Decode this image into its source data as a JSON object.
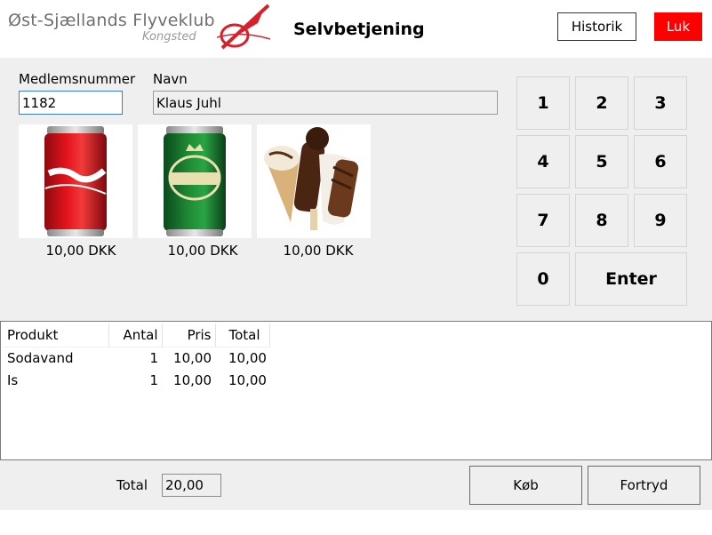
{
  "header": {
    "club_name": "Øst-Sjællands Flyveklub",
    "club_location": "Kongsted",
    "app_title": "Selvbetjening",
    "history_label": "Historik",
    "close_label": "Luk"
  },
  "member": {
    "number_label": "Medlemsnummer",
    "number_value": "1182",
    "name_label": "Navn",
    "name_value": "Klaus Juhl"
  },
  "products": [
    {
      "name": "coca-cola",
      "price": "10,00 DKK"
    },
    {
      "name": "tuborg",
      "price": "10,00 DKK"
    },
    {
      "name": "ice-cream",
      "price": "10,00 DKK"
    }
  ],
  "keypad": [
    "1",
    "2",
    "3",
    "4",
    "5",
    "6",
    "7",
    "8",
    "9",
    "0",
    "Enter"
  ],
  "order": {
    "headers": [
      "Produkt",
      "Antal",
      "Pris",
      "Total"
    ],
    "rows": [
      [
        "Sodavand",
        "1",
        "10,00",
        "10,00"
      ],
      [
        "Is",
        "1",
        "10,00",
        "10,00"
      ]
    ]
  },
  "footer": {
    "total_label": "Total",
    "total_value": "20,00",
    "buy_label": "Køb",
    "cancel_label": "Fortryd"
  },
  "colors": {
    "close_button": "#ff0000",
    "logo_red": "#d8202a",
    "panel_bg": "#efefef"
  }
}
